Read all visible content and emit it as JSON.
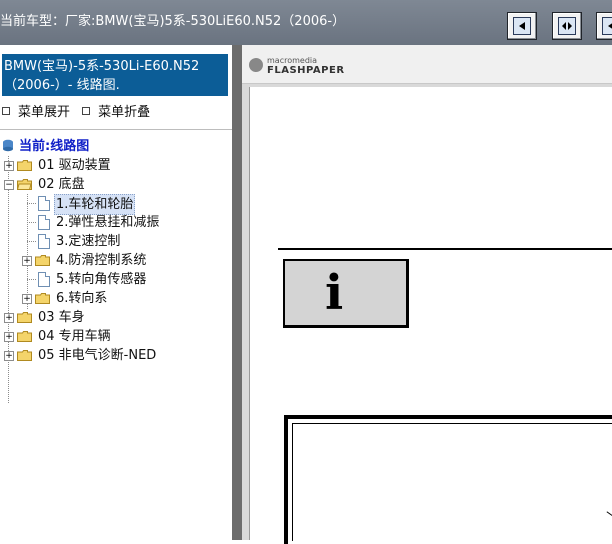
{
  "window": {
    "title": "当前车型：厂家:BMW(宝马)5系-530LiE60.N52（2006-）"
  },
  "toolbar": {
    "buttons": [
      "prev-page-icon",
      "fit-page-icon",
      "next-icon"
    ]
  },
  "sidebar": {
    "header_line1": "BMW(宝马)-5系-530Li-E60.N52",
    "header_line2": "（2006-）- 线路图.",
    "expand_label": "菜单展开",
    "collapse_label": "菜单折叠"
  },
  "tree": {
    "current": "当前:线路图",
    "items": [
      {
        "pm": "+",
        "label": "01 驱动装置"
      },
      {
        "pm": "−",
        "label": "02 底盘"
      },
      {
        "label": "1.车轮和轮胎"
      },
      {
        "label": "2.弹性悬挂和减振"
      },
      {
        "label": "3.定速控制"
      },
      {
        "pm": "+",
        "label": "4.防滑控制系统"
      },
      {
        "label": "5.转向角传感器"
      },
      {
        "pm": "+",
        "label": "6.转向系"
      },
      {
        "pm": "+",
        "label": "03 车身"
      },
      {
        "pm": "+",
        "label": "04 专用车辆"
      },
      {
        "pm": "+",
        "label": "05 非电气诊断-NED"
      }
    ]
  },
  "viewer": {
    "logo_top": "macromedia",
    "logo_bottom": "FLASHPAPER",
    "info_glyph": "i"
  },
  "colors": {
    "topbar": "#7f8894",
    "header": "#0c5d97",
    "selection": "#d6e2f6",
    "current_link": "#1020c8",
    "folder": "#f4d46a"
  }
}
